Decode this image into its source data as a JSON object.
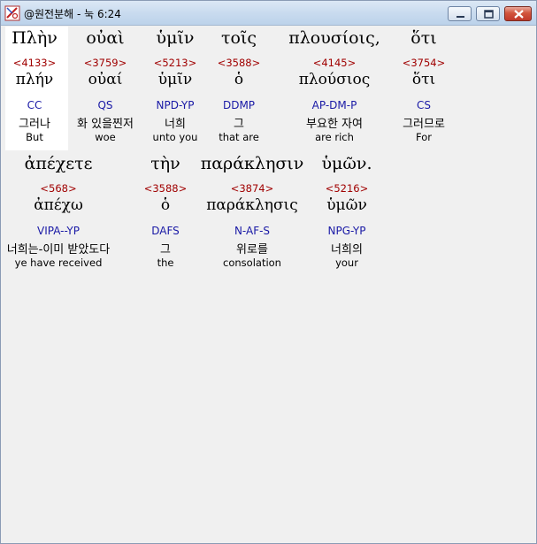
{
  "window": {
    "title": "@원전분해 - 눅 6:24"
  },
  "rows": [
    {
      "words": [
        {
          "greek": "Πλὴν",
          "strong": "<4133>",
          "lemma": "πλήν",
          "parse": "CC",
          "korean": "그러나",
          "english": "But"
        },
        {
          "greek": "οὐαὶ",
          "strong": "<3759>",
          "lemma": "οὐαί",
          "parse": "QS",
          "korean": "화 있을찐저",
          "english": "woe"
        },
        {
          "greek": "ὑμῖν",
          "strong": "<5213>",
          "lemma": "ὑμῖν",
          "parse": "NPD-YP",
          "korean": "너희",
          "english": "unto you"
        },
        {
          "greek": "τοῖς",
          "strong": "<3588>",
          "lemma": "ὁ",
          "parse": "DDMP",
          "korean": "그",
          "english": "that are"
        },
        {
          "greek": "πλουσίοις,",
          "strong": "<4145>",
          "lemma": "πλούσιος",
          "parse": "AP-DM-P",
          "korean": "부요한 자여",
          "english": "are rich"
        },
        {
          "greek": "ὅτι",
          "strong": "<3754>",
          "lemma": "ὅτι",
          "parse": "CS",
          "korean": "그러므로",
          "english": "For"
        }
      ]
    },
    {
      "words": [
        {
          "greek": "ἀπέχετε",
          "strong": "<568>",
          "lemma": "ἀπέχω",
          "parse": "VIPA--YP",
          "korean": "너희는-이미 받았도다",
          "english": "ye have received"
        },
        {
          "greek": "τὴν",
          "strong": "<3588>",
          "lemma": "ὁ",
          "parse": "DAFS",
          "korean": "그",
          "english": "the"
        },
        {
          "greek": "παράκλησιν",
          "strong": "<3874>",
          "lemma": "παράκλησις",
          "parse": "N-AF-S",
          "korean": "위로를",
          "english": "consolation"
        },
        {
          "greek": "ὑμῶν.",
          "strong": "<5216>",
          "lemma": "ὑμῶν",
          "parse": "NPG-YP",
          "korean": "너희의",
          "english": "your"
        }
      ]
    }
  ],
  "colors": {
    "strong": "#a00000",
    "parse": "#1a1aa6",
    "highlight": "#ffffff",
    "background": "#f0f0f0"
  },
  "icons": {
    "app": "app-logo-icon",
    "minimize": "minimize-icon",
    "maximize": "maximize-icon",
    "close": "close-icon"
  }
}
